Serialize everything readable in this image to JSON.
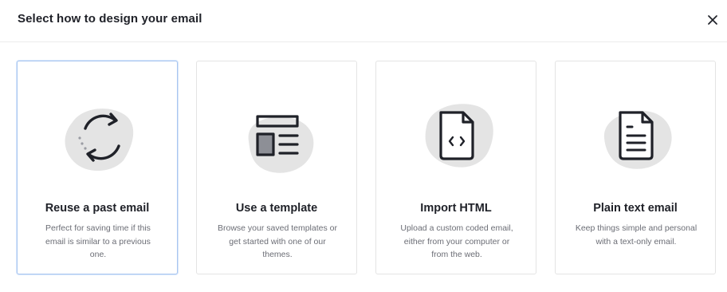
{
  "dialog": {
    "title": "Select how to design your email",
    "close_label": "×"
  },
  "options": [
    {
      "title": "Reuse a past email",
      "description": "Perfect for saving time if this email is similar to a previous one.",
      "icon": "refresh-icon",
      "selected": true
    },
    {
      "title": "Use a template",
      "description": "Browse your saved templates or get started with one of our themes.",
      "icon": "template-layout-icon",
      "selected": false
    },
    {
      "title": "Import HTML",
      "description": "Upload a custom coded email, either from your computer or from the web.",
      "icon": "code-file-icon",
      "selected": false
    },
    {
      "title": "Plain text email",
      "description": "Keep things simple and personal with a text-only email.",
      "icon": "text-document-icon",
      "selected": false
    }
  ],
  "colors": {
    "selected_border": "#a9c6f0",
    "blob": "#e4e4e4",
    "icon_stroke": "#1f2128",
    "muted_text": "#6b6d75"
  }
}
